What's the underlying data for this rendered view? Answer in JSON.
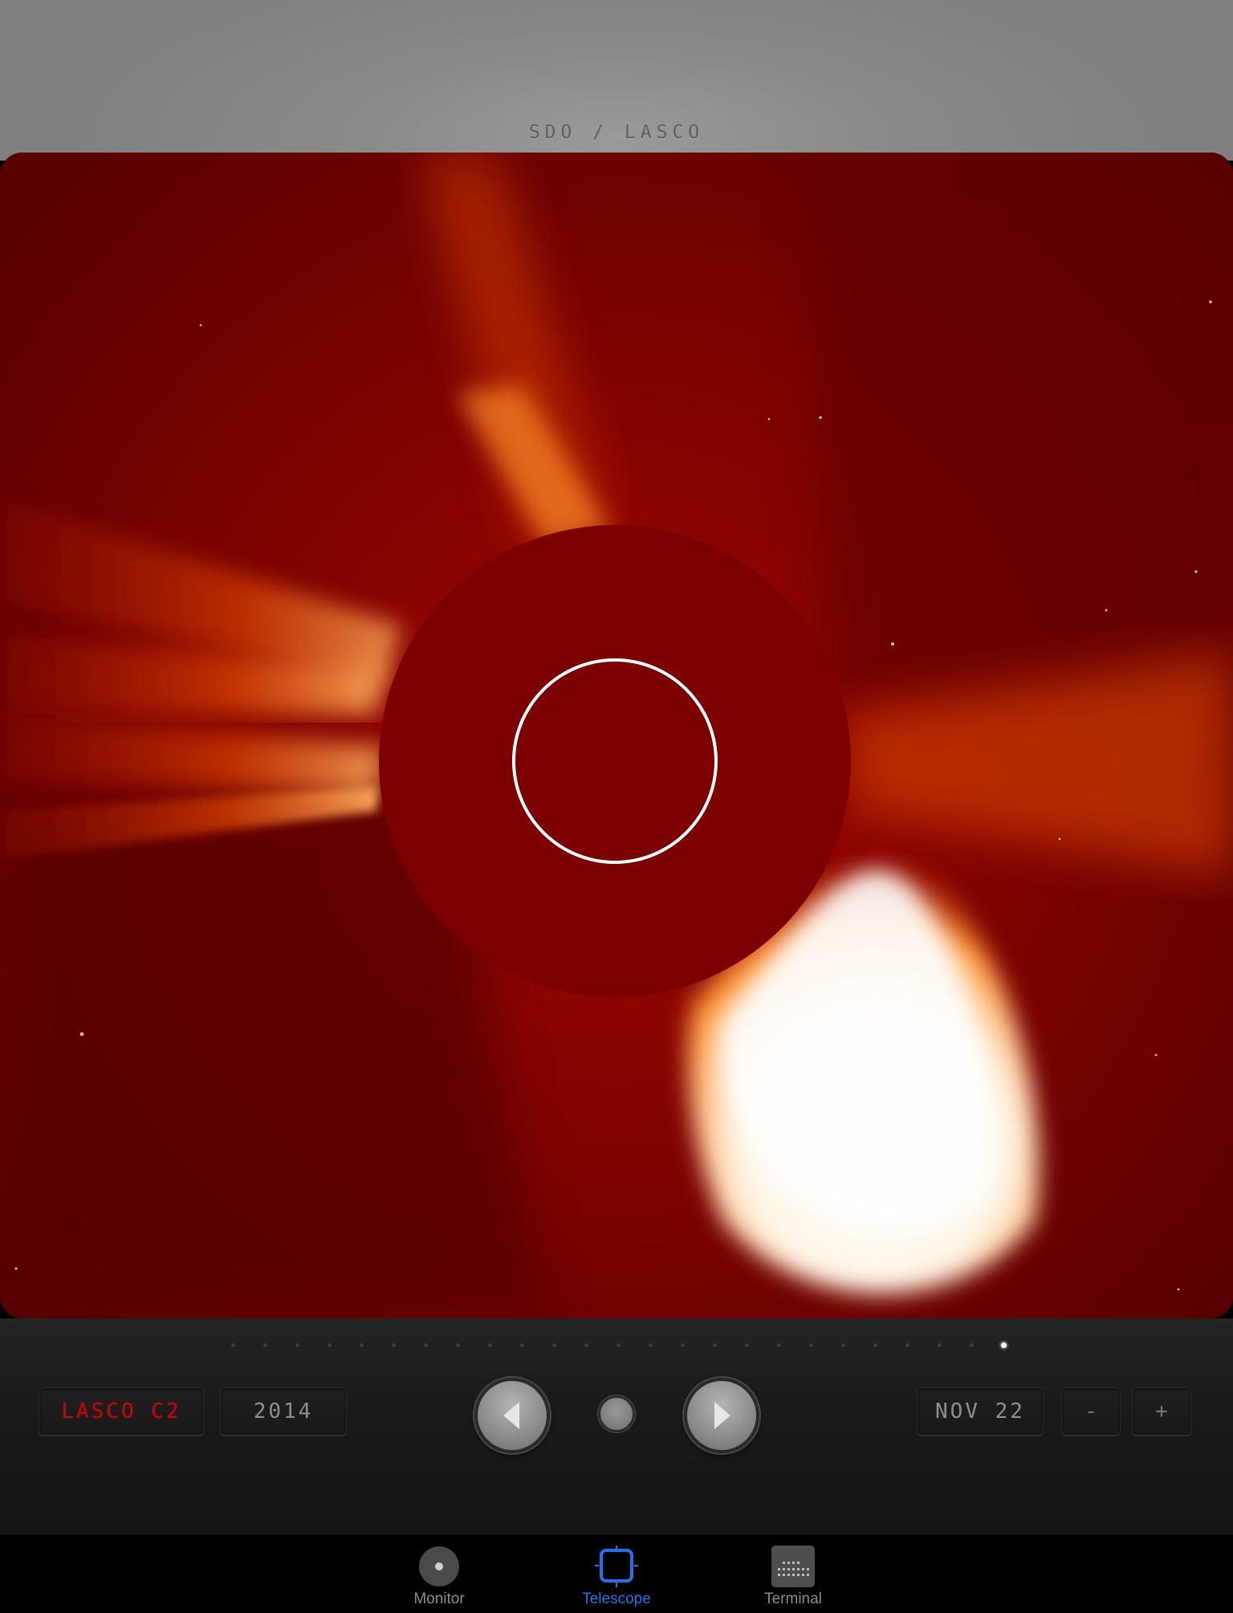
{
  "header": {
    "title": "SDO / LASCO"
  },
  "viewer": {
    "image_label": "LASCO C2 coronagraph image",
    "colors": {
      "background": "#6a0000",
      "occulter": "#7d0000",
      "sun_ring": "#ffffff",
      "cme": "#fff4e0"
    }
  },
  "frames": {
    "count": 25,
    "active_index": 24
  },
  "controls": {
    "instrument": "LASCO C2",
    "year": "2014",
    "date": "NOV 22",
    "zoom_out": "-",
    "zoom_in": "+",
    "prev_icon": "triangle-left-icon",
    "next_icon": "triangle-right-icon"
  },
  "tabs": [
    {
      "label": "Monitor",
      "icon": "monitor-icon",
      "active": false
    },
    {
      "label": "Telescope",
      "icon": "telescope-icon",
      "active": true
    },
    {
      "label": "Terminal",
      "icon": "terminal-icon",
      "active": false
    }
  ],
  "accent": "#1f73e8"
}
